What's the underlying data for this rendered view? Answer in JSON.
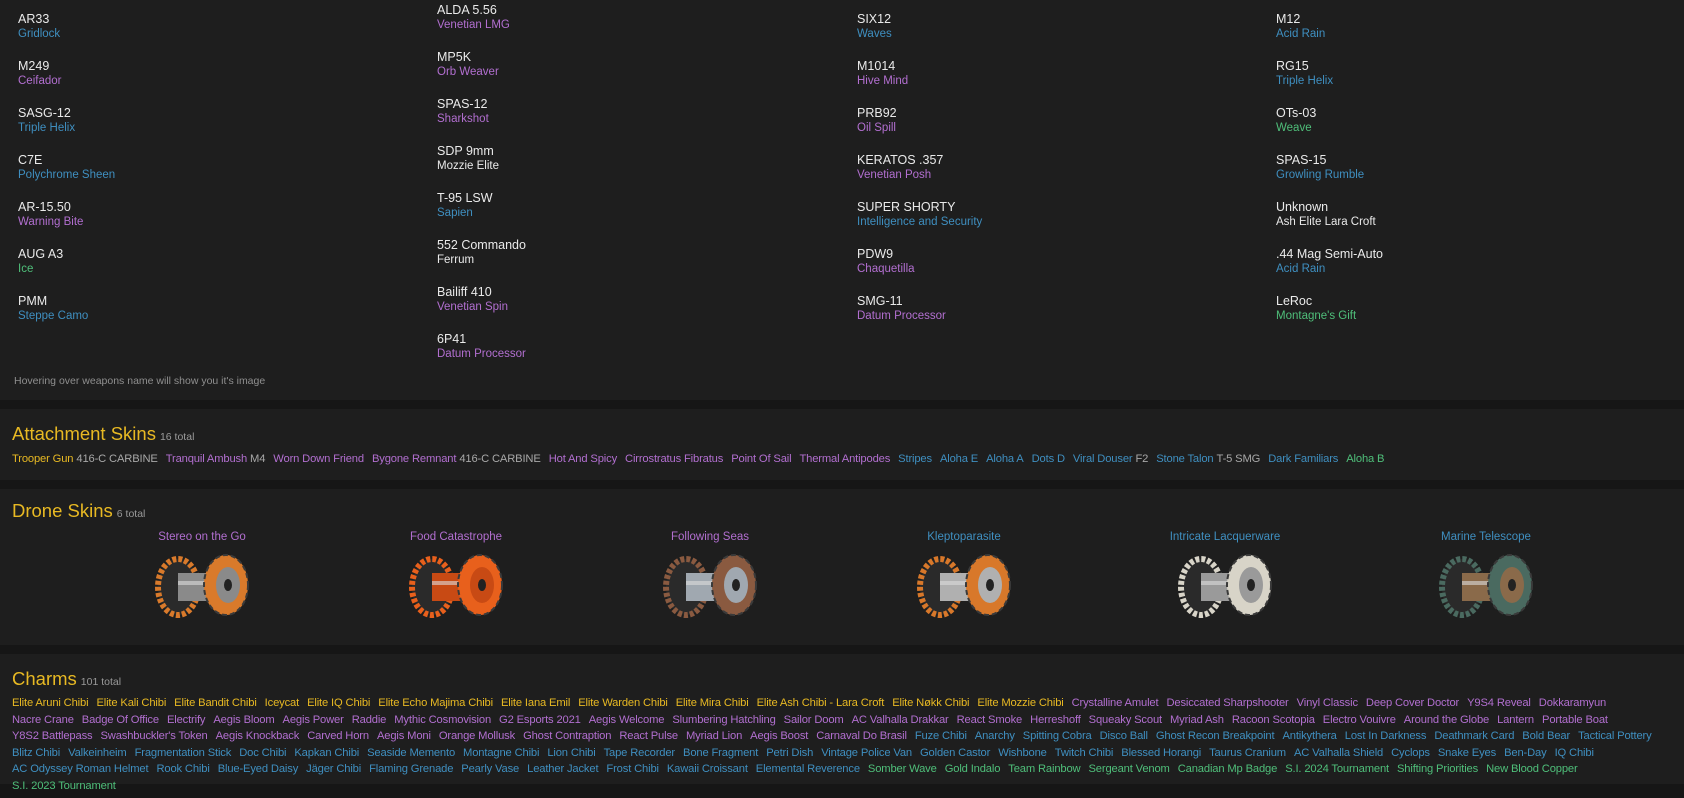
{
  "weapons": {
    "columns": [
      [
        {
          "name": "AR33",
          "skin": "Gridlock",
          "rarity": "rare"
        },
        {
          "name": "M249",
          "skin": "Ceifador",
          "rarity": "epic"
        },
        {
          "name": "SASG-12",
          "skin": "Triple Helix",
          "rarity": "rare"
        },
        {
          "name": "C7E",
          "skin": "Polychrome Sheen",
          "rarity": "rare"
        },
        {
          "name": "AR-15.50",
          "skin": "Warning Bite",
          "rarity": "epic"
        },
        {
          "name": "AUG A3",
          "skin": "Ice",
          "rarity": "uncommon"
        },
        {
          "name": "PMM",
          "skin": "Steppe Camo",
          "rarity": "rare"
        }
      ],
      [
        {
          "name": "ALDA 5.56",
          "skin": "Venetian LMG",
          "rarity": "epic"
        },
        {
          "name": "MP5K",
          "skin": "Orb Weaver",
          "rarity": "epic"
        },
        {
          "name": "SPAS-12",
          "skin": "Sharkshot",
          "rarity": "epic"
        },
        {
          "name": "SDP 9mm",
          "skin": "Mozzie Elite",
          "rarity": "plain"
        },
        {
          "name": "T-95 LSW",
          "skin": "Sapien",
          "rarity": "rare"
        },
        {
          "name": "552 Commando",
          "skin": "Ferrum",
          "rarity": "plain"
        },
        {
          "name": "Bailiff 410",
          "skin": "Venetian Spin",
          "rarity": "epic"
        },
        {
          "name": "6P41",
          "skin": "Datum Processor",
          "rarity": "epic"
        }
      ],
      [
        {
          "name": "SIX12",
          "skin": "Waves",
          "rarity": "rare"
        },
        {
          "name": "M1014",
          "skin": "Hive Mind",
          "rarity": "epic"
        },
        {
          "name": "PRB92",
          "skin": "Oil Spill",
          "rarity": "epic"
        },
        {
          "name": "KERATOS .357",
          "skin": "Venetian Posh",
          "rarity": "epic"
        },
        {
          "name": "SUPER SHORTY",
          "skin": "Intelligence and Security",
          "rarity": "rare"
        },
        {
          "name": "PDW9",
          "skin": "Chaquetilla",
          "rarity": "epic"
        },
        {
          "name": "SMG-11",
          "skin": "Datum Processor",
          "rarity": "epic"
        }
      ],
      [
        {
          "name": "M12",
          "skin": "Acid Rain",
          "rarity": "rare"
        },
        {
          "name": "RG15",
          "skin": "Triple Helix",
          "rarity": "rare"
        },
        {
          "name": "OTs-03",
          "skin": "Weave",
          "rarity": "uncommon"
        },
        {
          "name": "SPAS-15",
          "skin": "Growling Rumble",
          "rarity": "rare"
        },
        {
          "name": "Unknown",
          "skin": "Ash Elite Lara Croft",
          "rarity": "plain"
        },
        {
          "name": ".44 Mag Semi-Auto",
          "skin": "Acid Rain",
          "rarity": "rare"
        },
        {
          "name": "LeRoc",
          "skin": "Montagne's Gift",
          "rarity": "uncommon"
        }
      ]
    ],
    "hint": "Hovering over weapons name will show you it's image"
  },
  "attachments": {
    "title": "Attachment Skins",
    "count": "16 total",
    "items": [
      {
        "name": "Trooper Gun",
        "suffix": "416-C CARBINE",
        "rarity": "legendary"
      },
      {
        "name": "Tranquil Ambush",
        "suffix": "M4",
        "rarity": "epic"
      },
      {
        "name": "Worn Down Friend",
        "rarity": "epic"
      },
      {
        "name": "Bygone Remnant",
        "suffix": "416-C CARBINE",
        "rarity": "epic"
      },
      {
        "name": "Hot And Spicy",
        "rarity": "epic"
      },
      {
        "name": "Cirrostratus Fibratus",
        "rarity": "epic"
      },
      {
        "name": "Point Of Sail",
        "rarity": "epic"
      },
      {
        "name": "Thermal Antipodes",
        "rarity": "epic"
      },
      {
        "name": "Stripes",
        "rarity": "rare"
      },
      {
        "name": "Aloha E",
        "rarity": "rare"
      },
      {
        "name": "Aloha A",
        "rarity": "rare"
      },
      {
        "name": "Dots D",
        "rarity": "rare"
      },
      {
        "name": "Viral Douser",
        "suffix": "F2",
        "rarity": "rare"
      },
      {
        "name": "Stone Talon",
        "suffix": "T-5 SMG",
        "rarity": "rare"
      },
      {
        "name": "Dark Familiars",
        "rarity": "rare"
      },
      {
        "name": "Aloha B",
        "rarity": "uncommon"
      }
    ]
  },
  "drones": {
    "title": "Drone Skins",
    "count": "6 total",
    "items": [
      {
        "name": "Stereo on the Go",
        "rarity": "epic",
        "wheel": "#d97a2b",
        "hub": "#8a8a8a"
      },
      {
        "name": "Food Catastrophe",
        "rarity": "epic",
        "wheel": "#e8601c",
        "hub": "#c84a14"
      },
      {
        "name": "Following Seas",
        "rarity": "epic",
        "wheel": "#8a5a40",
        "hub": "#a0a8b0"
      },
      {
        "name": "Kleptoparasite",
        "rarity": "rare",
        "wheel": "#d8782a",
        "hub": "#b0b0b0"
      },
      {
        "name": "Intricate Lacquerware",
        "rarity": "rare",
        "wheel": "#d8d4c8",
        "hub": "#9a9a9a"
      },
      {
        "name": "Marine Telescope",
        "rarity": "rare",
        "wheel": "#4a6a60",
        "hub": "#8a6a4a"
      }
    ]
  },
  "charms": {
    "title": "Charms",
    "count": "101 total",
    "groups": [
      {
        "rarity": "legendary",
        "items": [
          "Elite Aruni Chibi",
          "Elite Kali Chibi",
          "Elite Bandit Chibi",
          "Iceycat",
          "Elite IQ Chibi",
          "Elite Echo Majima Chibi",
          "Elite Iana Emil",
          "Elite Warden Chibi",
          "Elite Mira Chibi",
          "Elite Ash Chibi - Lara Croft",
          "Elite Nøkk Chibi",
          "Elite Mozzie Chibi"
        ]
      },
      {
        "rarity": "epic",
        "items": [
          "Crystalline Amulet",
          "Desiccated Sharpshooter",
          "Vinyl Classic",
          "Deep Cover Doctor",
          "Y9S4 Reveal",
          "Dokkaramyun",
          "Nacre Crane",
          "Badge Of Office",
          "Electrify",
          "Aegis Bloom",
          "Aegis Power",
          "Raddie",
          "Mythic Cosmovision",
          "G2 Esports 2021",
          "Aegis Welcome",
          "Slumbering Hatchling",
          "Sailor Doom",
          "AC Valhalla Drakkar",
          "React Smoke",
          "Herreshoff",
          "Squeaky Scout",
          "Myriad Ash",
          "Racoon Scotopia",
          "Electro Vouivre",
          "Around the Globe",
          "Lantern",
          "Portable Boat",
          "Y8S2 Battlepass",
          "Swashbuckler's Token",
          "Aegis Knockback",
          "Carved Horn",
          "Aegis Moni",
          "Orange Mollusk",
          "Ghost Contraption",
          "React Pulse",
          "Myriad Lion",
          "Aegis Boost",
          "Carnaval Do Brasil"
        ]
      },
      {
        "rarity": "rare",
        "items": [
          "Fuze Chibi",
          "Anarchy",
          "Spitting Cobra",
          "Disco Ball",
          "Ghost Recon Breakpoint",
          "Antikythera",
          "Lost In Darkness",
          "Deathmark Card",
          "Bold Bear",
          "Tactical Pottery",
          "Blitz Chibi",
          "Valkeinheim",
          "Fragmentation Stick",
          "Doc Chibi",
          "Kapkan Chibi",
          "Seaside Memento",
          "Montagne Chibi",
          "Lion Chibi",
          "Tape Recorder",
          "Bone Fragment",
          "Petri Dish",
          "Vintage Police Van",
          "Golden Castor",
          "Wishbone",
          "Twitch Chibi",
          "Blessed Horangi",
          "Taurus Cranium",
          "AC Valhalla Shield",
          "Cyclops",
          "Snake Eyes",
          "Ben-Day",
          "IQ Chibi",
          "AC Odyssey Roman Helmet",
          "Rook Chibi",
          "Blue-Eyed Daisy",
          "Jäger Chibi",
          "Flaming Grenade",
          "Pearly Vase",
          "Leather Jacket",
          "Frost Chibi",
          "Kawaii Croissant",
          "Elemental Reverence"
        ]
      },
      {
        "rarity": "uncommon",
        "items": [
          "Somber Wave",
          "Gold Indalo",
          "Team Rainbow",
          "Sergeant Venom",
          "Canadian Mp Badge",
          "S.I. 2024 Tournament",
          "Shifting Priorities",
          "New Blood Copper",
          "S.I. 2023 Tournament"
        ]
      }
    ]
  }
}
